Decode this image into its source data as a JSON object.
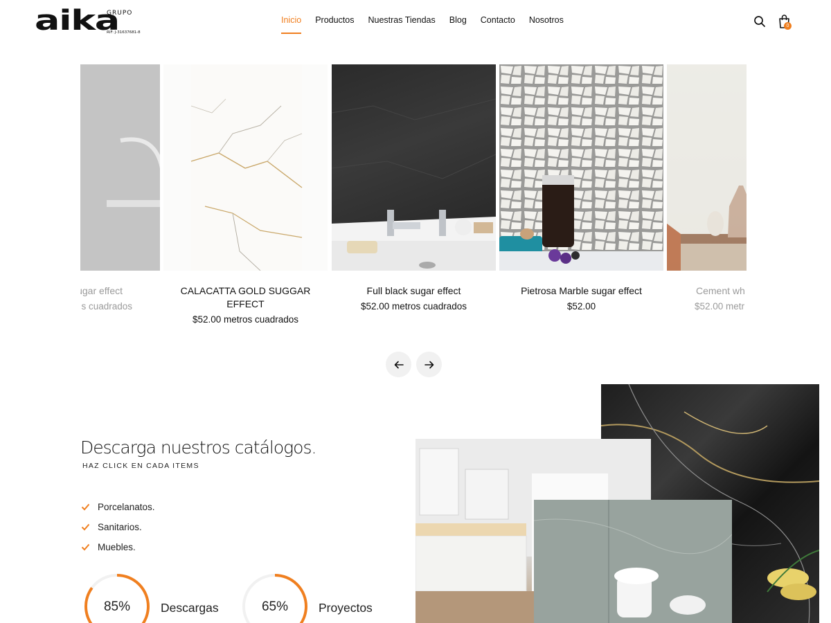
{
  "header": {
    "logo_text": "aika",
    "logo_tag": "GRUPO",
    "logo_rif": "RIF: J-31637681-8",
    "nav": [
      "Inicio",
      "Productos",
      "Nuestras Tiendas",
      "Blog",
      "Contacto",
      "Nosotros"
    ],
    "active_nav": "Inicio",
    "cart_count": "0",
    "accent": "#f07f1f"
  },
  "products": [
    {
      "name": "ugar effect",
      "price": "s cuadrados",
      "faded": true
    },
    {
      "name": "CALACATTA GOLD SUGGAR EFFECT",
      "price": "$52.00 metros cuadrados",
      "faded": false
    },
    {
      "name": "Full black sugar effect",
      "price": "$52.00 metros cuadrados",
      "faded": false
    },
    {
      "name": "Pietrosa Marble sugar effect",
      "price": "$52.00",
      "faded": false
    },
    {
      "name": "Cement wh",
      "price": "$52.00 metr",
      "faded": true
    }
  ],
  "catalog": {
    "title": "Descarga nuestros catálogos.",
    "subtitle": "HAZ CLICK EN CADA ITEMS",
    "items": [
      "Porcelanatos.",
      "Sanitarios.",
      "Muebles."
    ],
    "stats": [
      {
        "percent": 85,
        "percent_label": "85%",
        "label": "Descargas"
      },
      {
        "percent": 65,
        "percent_label": "65%",
        "label": "Proyectos"
      }
    ]
  },
  "icons": {
    "search": "search-icon",
    "cart": "shopping-bag-icon",
    "prev": "arrow-left-icon",
    "next": "arrow-right-icon",
    "check": "check-icon"
  }
}
